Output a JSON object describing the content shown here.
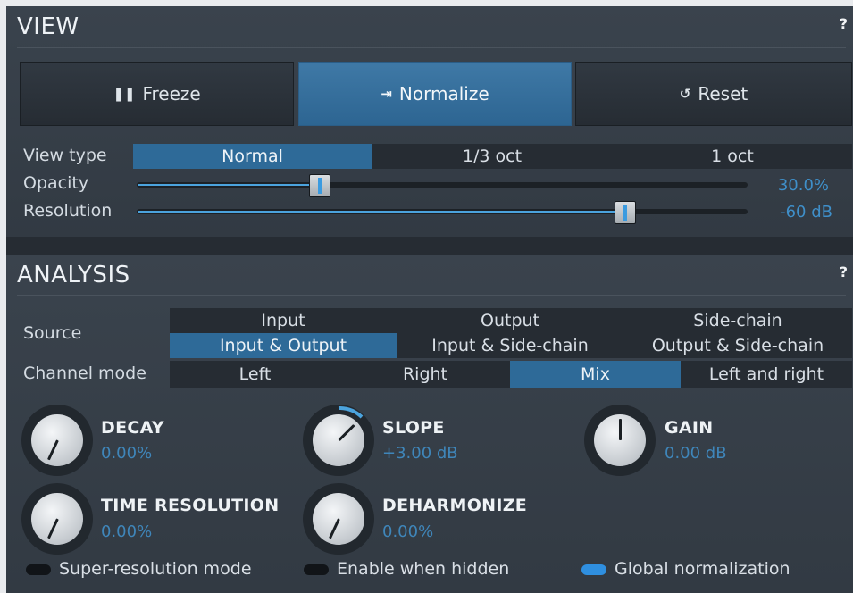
{
  "view": {
    "title": "VIEW",
    "help": "?",
    "buttons": {
      "freeze": "Freeze",
      "normalize": "Normalize",
      "reset": "Reset"
    },
    "icons": {
      "freeze": "pause-icon",
      "normalize": "normalize-icon",
      "reset": "reset-icon"
    },
    "view_type": {
      "label": "View type",
      "options": [
        "Normal",
        "1/3 oct",
        "1 oct"
      ],
      "selected": "Normal"
    },
    "opacity": {
      "label": "Opacity",
      "value": "30.0%",
      "level": 0.3
    },
    "resolution": {
      "label": "Resolution",
      "value": "-60 dB",
      "level": 0.8
    }
  },
  "analysis": {
    "title": "ANALYSIS",
    "help": "?",
    "source": {
      "label": "Source",
      "options": [
        "Input",
        "Output",
        "Side-chain",
        "Input & Output",
        "Input & Side-chain",
        "Output & Side-chain"
      ],
      "selected": "Input & Output"
    },
    "channel_mode": {
      "label": "Channel mode",
      "options": [
        "Left",
        "Right",
        "Mix",
        "Left and right"
      ],
      "selected": "Mix"
    },
    "knobs": {
      "decay": {
        "name": "DECAY",
        "value": "0.00%"
      },
      "slope": {
        "name": "SLOPE",
        "value": "+3.00 dB"
      },
      "gain": {
        "name": "GAIN",
        "value": "0.00 dB"
      },
      "time_resolution": {
        "name": "TIME RESOLUTION",
        "value": "0.00%"
      },
      "deharmonize": {
        "name": "DEHARMONIZE",
        "value": "0.00%"
      }
    },
    "toggles": {
      "super_resolution": {
        "label": "Super-resolution mode",
        "on": false
      },
      "enable_hidden": {
        "label": "Enable when hidden",
        "on": false
      },
      "global_normalization": {
        "label": "Global normalization",
        "on": true
      }
    }
  },
  "colors": {
    "accent": "#2e6a98",
    "value_text": "#3f8fc9",
    "toggle_on": "#2f8fe0"
  }
}
